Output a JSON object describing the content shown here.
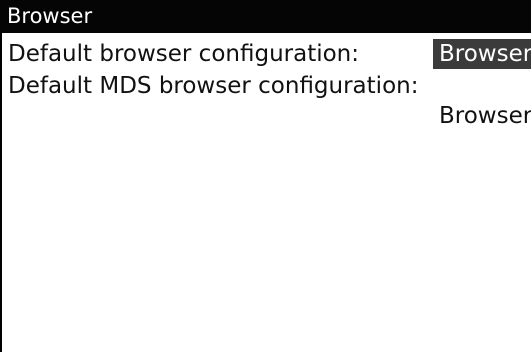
{
  "window": {
    "title": "Browser"
  },
  "settings": [
    {
      "label": "Default browser configuration:",
      "value": "Browser",
      "selected": true
    },
    {
      "label": "Default MDS browser configuration:",
      "value": "Browser",
      "selected": false
    }
  ],
  "colors": {
    "title_bar_bg": "#050505",
    "title_text": "#ffffff",
    "selection_bg": "#3b3b3b",
    "selection_text": "#ffffff",
    "body_text": "#111111",
    "background": "#ffffff"
  }
}
